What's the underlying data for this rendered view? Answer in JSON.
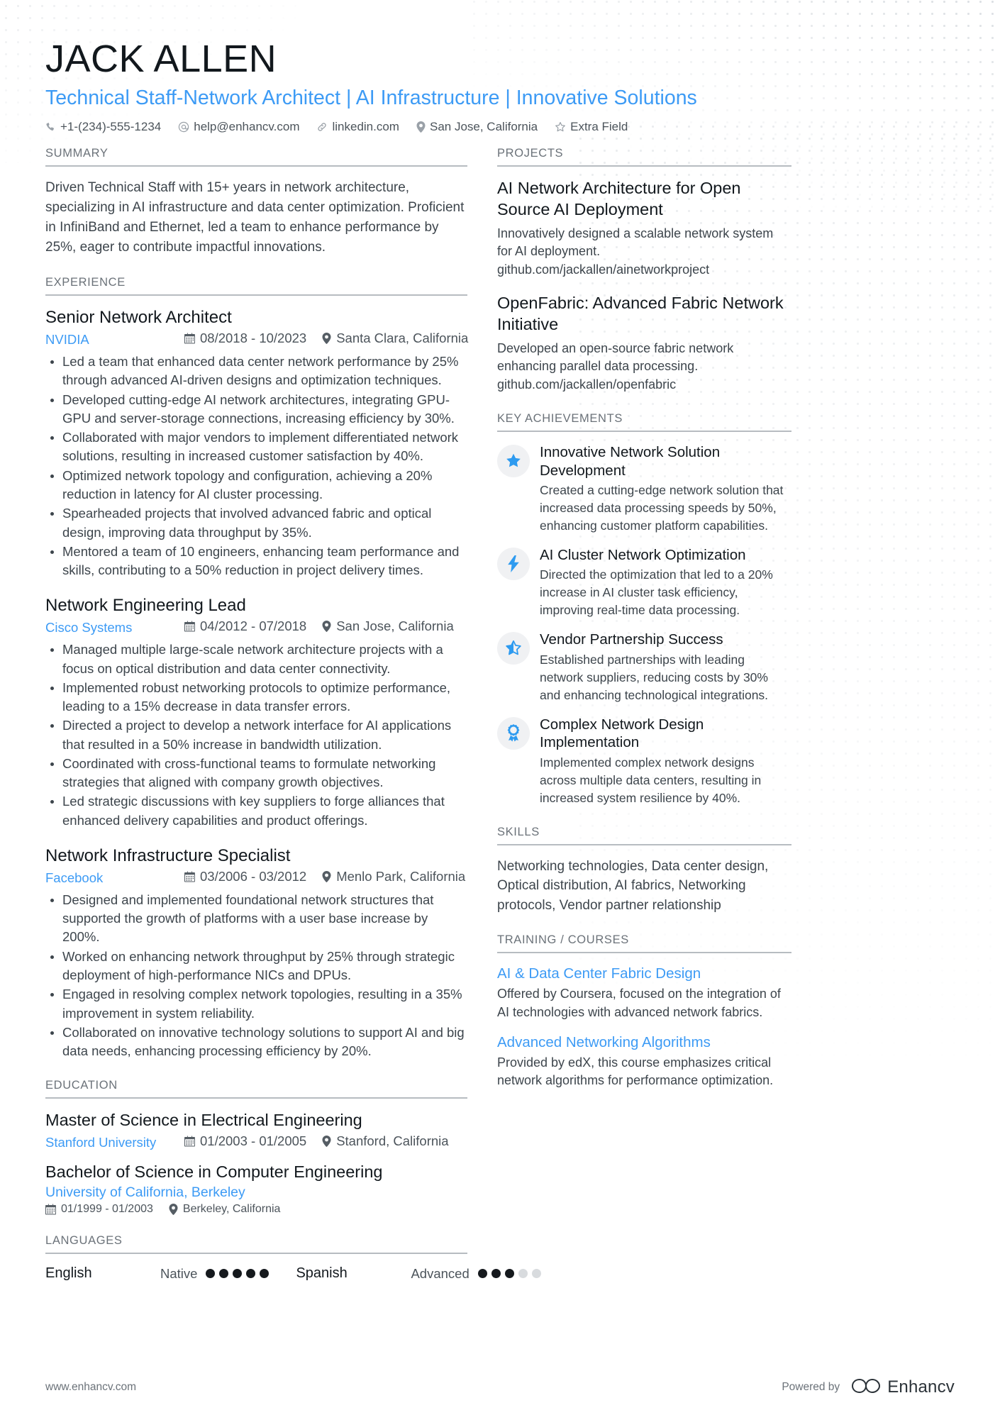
{
  "header": {
    "name": "JACK ALLEN",
    "headline": "Technical Staff-Network Architect | AI Infrastructure | Innovative Solutions",
    "contacts": [
      {
        "icon": "phone-icon",
        "text": "+1-(234)-555-1234"
      },
      {
        "icon": "email-icon",
        "text": "help@enhancv.com"
      },
      {
        "icon": "link-icon",
        "text": "linkedin.com"
      },
      {
        "icon": "location-pin-icon",
        "text": "San Jose, California"
      },
      {
        "icon": "star-outline-icon",
        "text": "Extra Field"
      }
    ]
  },
  "sections": {
    "summary_title": "SUMMARY",
    "experience_title": "EXPERIENCE",
    "education_title": "EDUCATION",
    "languages_title": "LANGUAGES",
    "projects_title": "PROJECTS",
    "key_achievements_title": "KEY ACHIEVEMENTS",
    "skills_title": "SKILLS",
    "training_title": "TRAINING / COURSES"
  },
  "summary": {
    "text": "Driven Technical Staff with 15+ years in network architecture, specializing in AI infrastructure and data center optimization. Proficient in InfiniBand and Ethernet, led a team to enhance performance by 25%, eager to contribute impactful innovations."
  },
  "experience": [
    {
      "title": "Senior Network Architect",
      "company": "NVIDIA",
      "dates": "08/2018 - 10/2023",
      "location": "Santa Clara, California",
      "bullets": [
        "Led a team that enhanced data center network performance by 25% through advanced AI-driven designs and optimization techniques.",
        "Developed cutting-edge AI network architectures, integrating GPU-GPU and server-storage connections, increasing efficiency by 30%.",
        "Collaborated with major vendors to implement differentiated network solutions, resulting in increased customer satisfaction by 40%.",
        "Optimized network topology and configuration, achieving a 20% reduction in latency for AI cluster processing.",
        "Spearheaded projects that involved advanced fabric and optical design, improving data throughput by 35%.",
        "Mentored a team of 10 engineers, enhancing team performance and skills, contributing to a 50% reduction in project delivery times."
      ]
    },
    {
      "title": "Network Engineering Lead",
      "company": "Cisco Systems",
      "dates": "04/2012 - 07/2018",
      "location": "San Jose, California",
      "bullets": [
        "Managed multiple large-scale network architecture projects with a focus on optical distribution and data center connectivity.",
        "Implemented robust networking protocols to optimize performance, leading to a 15% decrease in data transfer errors.",
        "Directed a project to develop a network interface for AI applications that resulted in a 50% increase in bandwidth utilization.",
        "Coordinated with cross-functional teams to formulate networking strategies that aligned with company growth objectives.",
        "Led strategic discussions with key suppliers to forge alliances that enhanced delivery capabilities and product offerings."
      ]
    },
    {
      "title": "Network Infrastructure Specialist",
      "company": "Facebook",
      "dates": "03/2006 - 03/2012",
      "location": "Menlo Park, California",
      "bullets": [
        "Designed and implemented foundational network structures that supported the growth of platforms with a user base increase by 200%.",
        "Worked on enhancing network throughput by 25% through strategic deployment of high-performance NICs and DPUs.",
        "Engaged in resolving complex network topologies, resulting in a 35% improvement in system reliability.",
        "Collaborated on innovative technology solutions to support AI and big data needs, enhancing processing efficiency by 20%."
      ]
    }
  ],
  "education": [
    {
      "degree": "Master of Science in Electrical Engineering",
      "school": "Stanford University",
      "dates": "01/2003 - 01/2005",
      "location": "Stanford, California",
      "stacked": false
    },
    {
      "degree": "Bachelor of Science in Computer Engineering",
      "school": "University of California, Berkeley",
      "dates": "01/1999 - 01/2003",
      "location": "Berkeley, California",
      "stacked": true
    }
  ],
  "languages": [
    {
      "name": "English",
      "level": "Native",
      "filled": 5,
      "total": 5
    },
    {
      "name": "Spanish",
      "level": "Advanced",
      "filled": 3,
      "total": 5
    }
  ],
  "projects": [
    {
      "title": "AI Network Architecture for Open Source AI Deployment",
      "desc": "Innovatively designed a scalable network system for AI deployment. github.com/jackallen/ainetworkproject"
    },
    {
      "title": "OpenFabric: Advanced Fabric Network Initiative",
      "desc": "Developed an open-source fabric network enhancing parallel data processing. github.com/jackallen/openfabric"
    }
  ],
  "key_achievements": [
    {
      "icon": "star-filled-icon",
      "title": "Innovative Network Solution Development",
      "desc": "Created a cutting-edge network solution that increased data processing speeds by 50%, enhancing customer platform capabilities."
    },
    {
      "icon": "lightning-bolt-icon",
      "title": "AI Cluster Network Optimization",
      "desc": "Directed the optimization that led to a 20% increase in AI cluster task efficiency, improving real-time data processing."
    },
    {
      "icon": "star-half-icon",
      "title": "Vendor Partnership Success",
      "desc": "Established partnerships with leading network suppliers, reducing costs by 30% and enhancing technological integrations."
    },
    {
      "icon": "award-ribbon-icon",
      "title": "Complex Network Design Implementation",
      "desc": "Implemented complex network designs across multiple data centers, resulting in increased system resilience by 40%."
    }
  ],
  "skills": {
    "text": "Networking technologies, Data center design, Optical distribution, AI fabrics, Networking protocols, Vendor partner relationship"
  },
  "training": [
    {
      "title": "AI & Data Center Fabric Design",
      "desc": "Offered by Coursera, focused on the integration of AI technologies with advanced network fabrics."
    },
    {
      "title": "Advanced Networking Algorithms",
      "desc": "Provided by edX, this course emphasizes critical network algorithms for performance optimization."
    }
  ],
  "footer": {
    "url": "www.enhancv.com",
    "powered_by": "Powered by",
    "brand": "Enhancv"
  },
  "colors": {
    "accent": "#3d9bf5",
    "heading": "#6b7279",
    "rule": "#b7bcc1",
    "body_text": "#3d454c",
    "dot_on": "#15191d",
    "dot_off": "#d8dbde"
  }
}
